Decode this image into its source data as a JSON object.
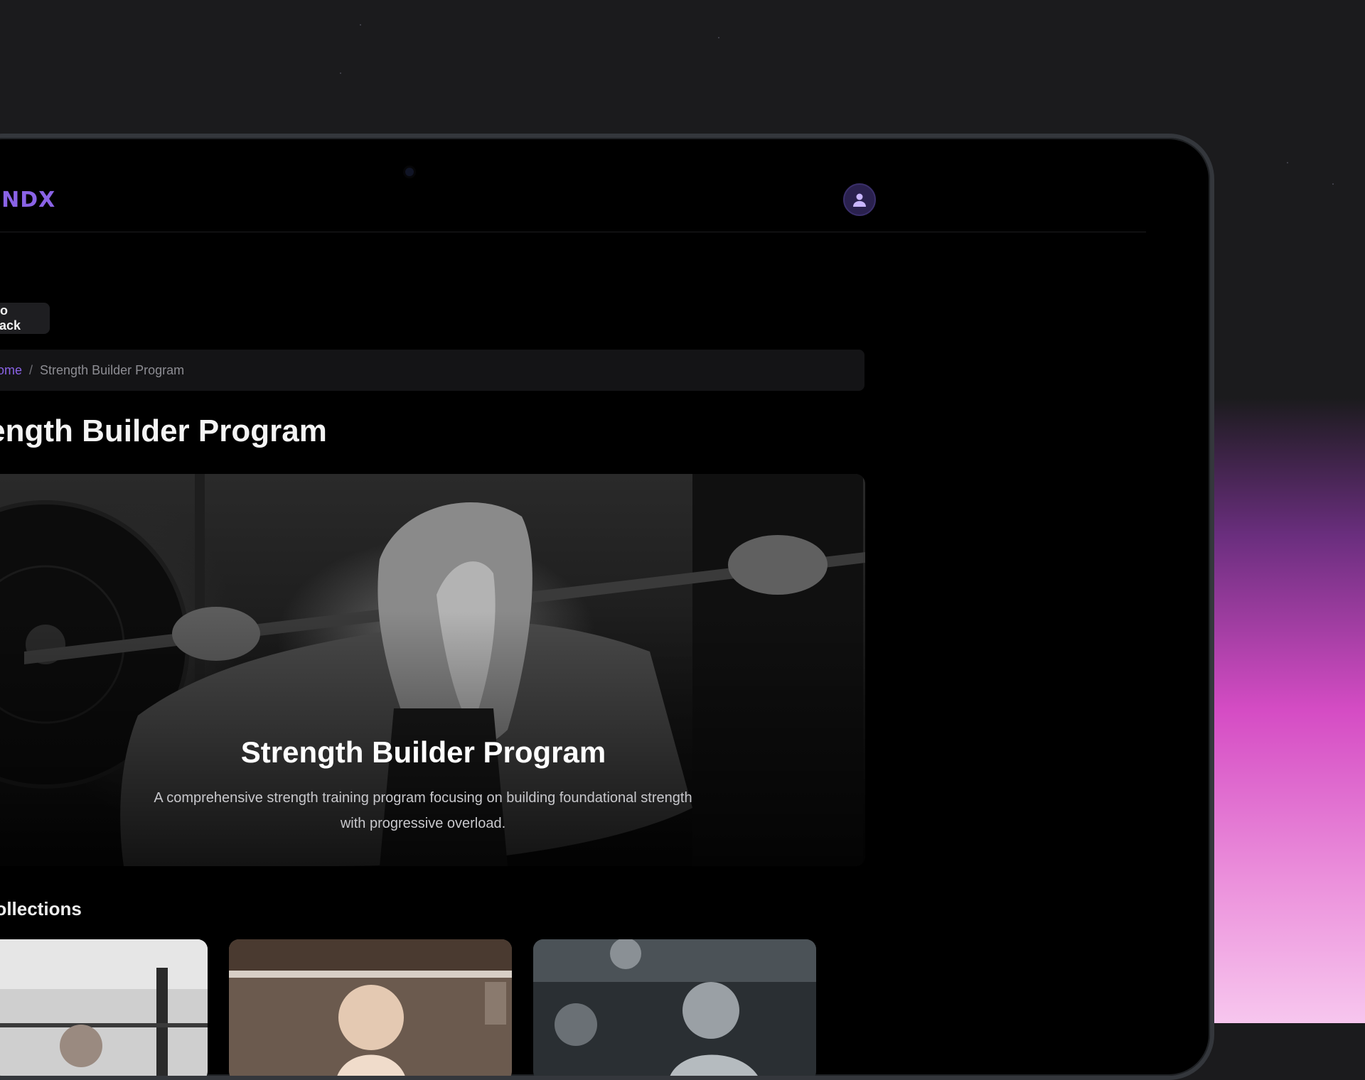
{
  "nav": {
    "logo": "INDX",
    "avatar_icon": "user-icon"
  },
  "back_button": {
    "label": "Go Back"
  },
  "breadcrumb": {
    "home": "ome",
    "separator": "/",
    "current": "Strength Builder Program"
  },
  "page_title": "rength Builder Program",
  "hero": {
    "title": "Strength Builder Program",
    "description_line1": "A comprehensive strength training program focusing on building foundational strength",
    "description_line2": "with progressive overload."
  },
  "section": {
    "title": "-Collections"
  },
  "colors": {
    "accent": "#8a63e6",
    "background": "#000000",
    "panel": "#141416"
  }
}
